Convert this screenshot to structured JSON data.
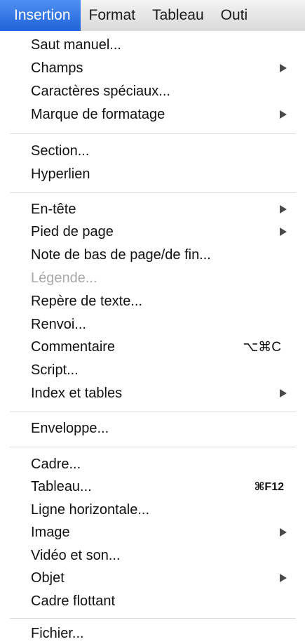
{
  "menubar": {
    "items": [
      "Insertion",
      "Format",
      "Tableau",
      "Outi"
    ]
  },
  "menu": {
    "group1": [
      {
        "label": "Saut manuel..."
      },
      {
        "label": "Champs",
        "submenu": true
      },
      {
        "label": "Caractères spéciaux..."
      },
      {
        "label": "Marque de formatage",
        "submenu": true
      }
    ],
    "group2": [
      {
        "label": "Section..."
      },
      {
        "label": "Hyperlien"
      }
    ],
    "group3": [
      {
        "label": "En-tête",
        "submenu": true
      },
      {
        "label": "Pied de page",
        "submenu": true
      },
      {
        "label": "Note de bas de page/de fin..."
      },
      {
        "label": "Légende...",
        "disabled": true
      },
      {
        "label": "Repère de texte..."
      },
      {
        "label": "Renvoi..."
      },
      {
        "label": "Commentaire",
        "shortcut": "⌥⌘C"
      },
      {
        "label": "Script..."
      },
      {
        "label": "Index et tables",
        "submenu": true
      }
    ],
    "group4": [
      {
        "label": "Enveloppe..."
      }
    ],
    "group5": [
      {
        "label": "Cadre..."
      },
      {
        "label": "Tableau...",
        "shortcut": "⌘F12"
      },
      {
        "label": "Ligne horizontale..."
      },
      {
        "label": "Image",
        "submenu": true
      },
      {
        "label": "Vidéo et son..."
      },
      {
        "label": "Objet",
        "submenu": true
      },
      {
        "label": "Cadre flottant"
      }
    ],
    "group6": [
      {
        "label": "Fichier..."
      }
    ]
  },
  "colors": {
    "highlight": "#2f73e3",
    "disabled_text": "#a8a8a8"
  }
}
